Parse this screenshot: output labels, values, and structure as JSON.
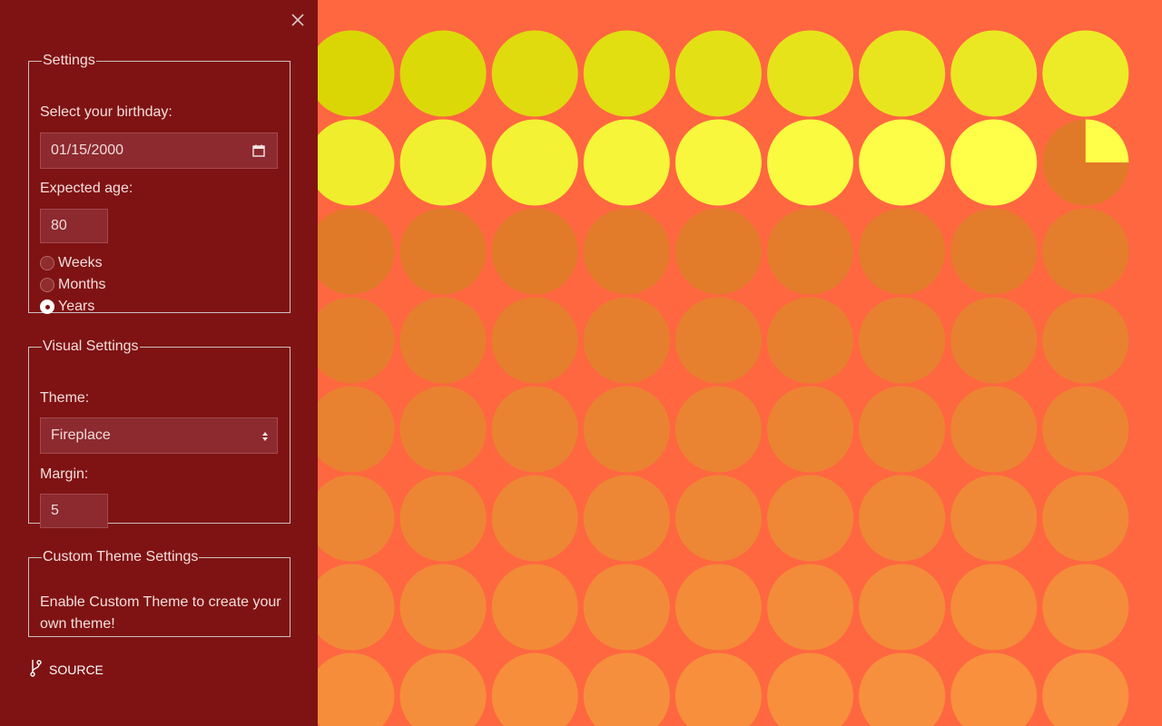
{
  "settings": {
    "legend": "Settings",
    "birthday_label": "Select your birthday:",
    "birthday_value": "01/15/2000",
    "expected_age_label": "Expected age:",
    "expected_age_value": "80",
    "units": [
      {
        "label": "Weeks",
        "selected": false
      },
      {
        "label": "Months",
        "selected": false
      },
      {
        "label": "Years",
        "selected": true
      }
    ]
  },
  "visual_settings": {
    "legend": "Visual Settings",
    "theme_label": "Theme:",
    "theme_value": "Fireplace",
    "margin_label": "Margin:",
    "margin_value": "5"
  },
  "custom_theme": {
    "legend": "Custom Theme Settings",
    "message": "Enable Custom Theme to create your own theme!"
  },
  "source_link": "SOURCE",
  "icons": {
    "close": "close-icon",
    "source": "git-branch-icon",
    "calendar": "calendar-icon",
    "select_arrows": "select-arrows-icon"
  },
  "colors": {
    "sidebar_bg": "#7f1313",
    "page_bg": "#ff6740",
    "lived_start": "#dad605",
    "lived_end": "#ffff4a",
    "future_start": "#e07a28",
    "future_end": "#fc9442"
  },
  "life_grid": {
    "total_years": 80,
    "years_lived": 17,
    "current_year_progress": 0.25,
    "columns_visible": 9,
    "rows_visible": 7
  }
}
